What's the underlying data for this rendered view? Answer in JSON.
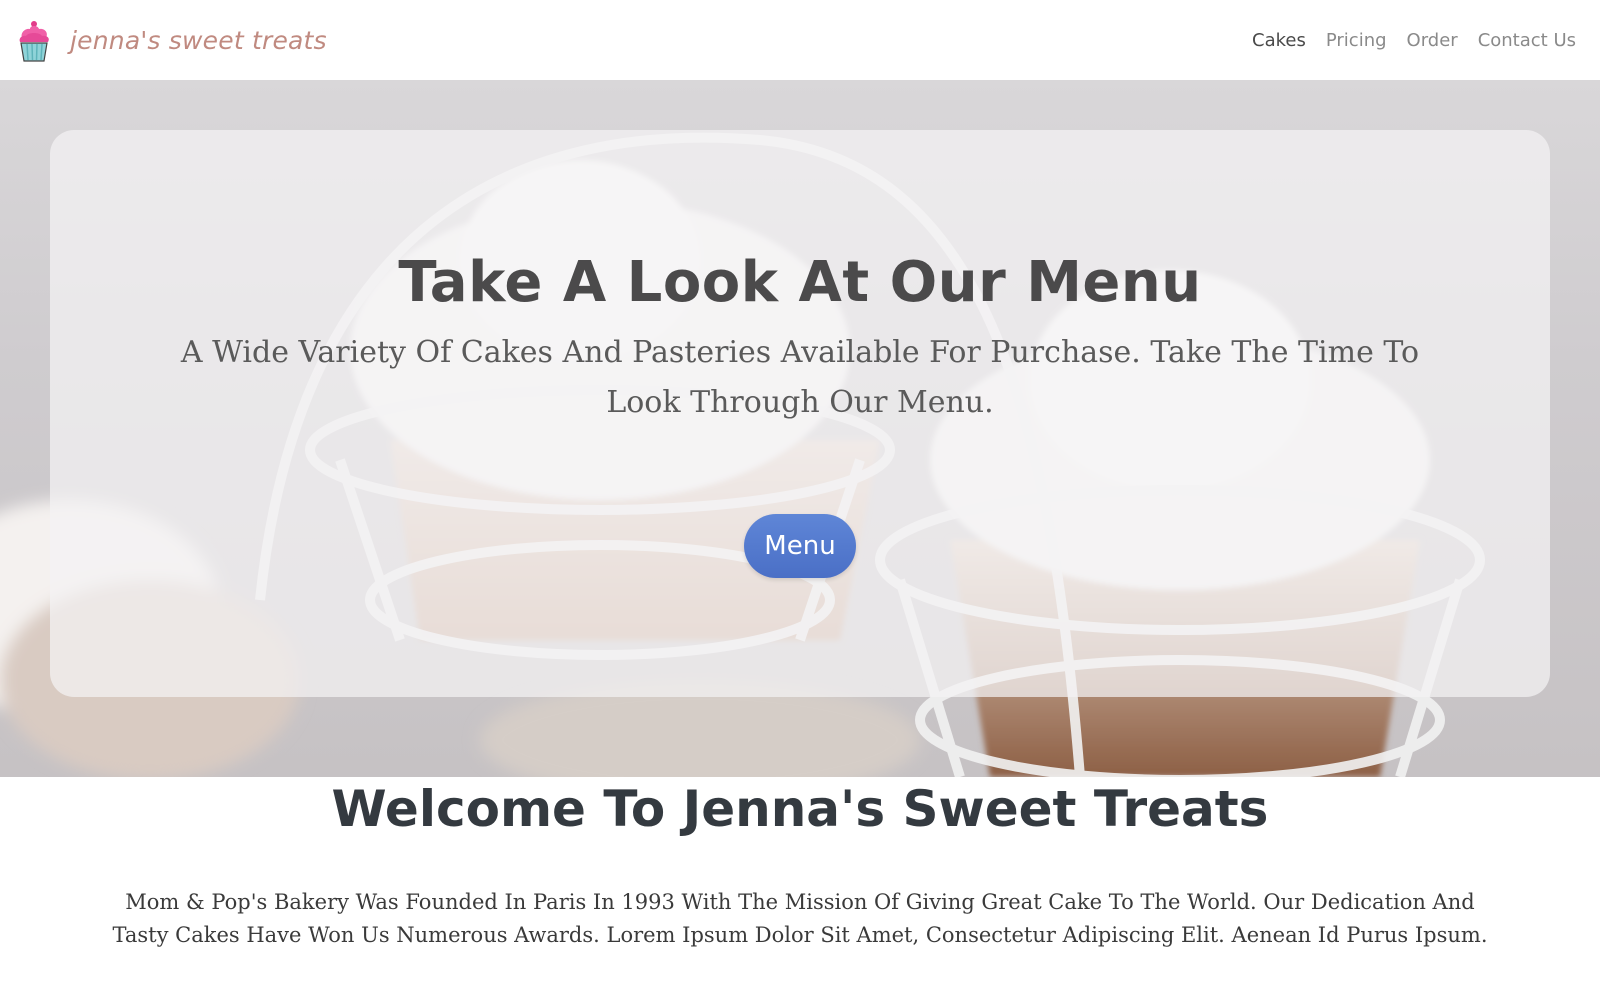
{
  "brand": {
    "name": "jenna's sweet treats",
    "logo_icon": "cupcake-icon",
    "accent_color": "#c08a80"
  },
  "nav": {
    "items": [
      {
        "label": "Cakes",
        "active": true
      },
      {
        "label": "Pricing",
        "active": false
      },
      {
        "label": "Order",
        "active": false
      },
      {
        "label": "Contact Us",
        "active": false
      }
    ]
  },
  "hero": {
    "title": "Take A Look At Our Menu",
    "subtitle": "A Wide Variety Of Cakes And Pasteries Available For Purchase. Take The Time To Look Through Our Menu.",
    "button_label": "Menu",
    "button_color": "#4f74c9"
  },
  "welcome": {
    "title": "Welcome To Jenna's Sweet Treats",
    "text": "Mom & Pop's Bakery Was Founded In Paris In 1993 With The Mission Of Giving Great Cake To The World. Our Dedication And Tasty Cakes Have Won Us Numerous Awards. Lorem Ipsum Dolor Sit Amet, Consectetur Adipiscing Elit. Aenean Id Purus Ipsum."
  }
}
